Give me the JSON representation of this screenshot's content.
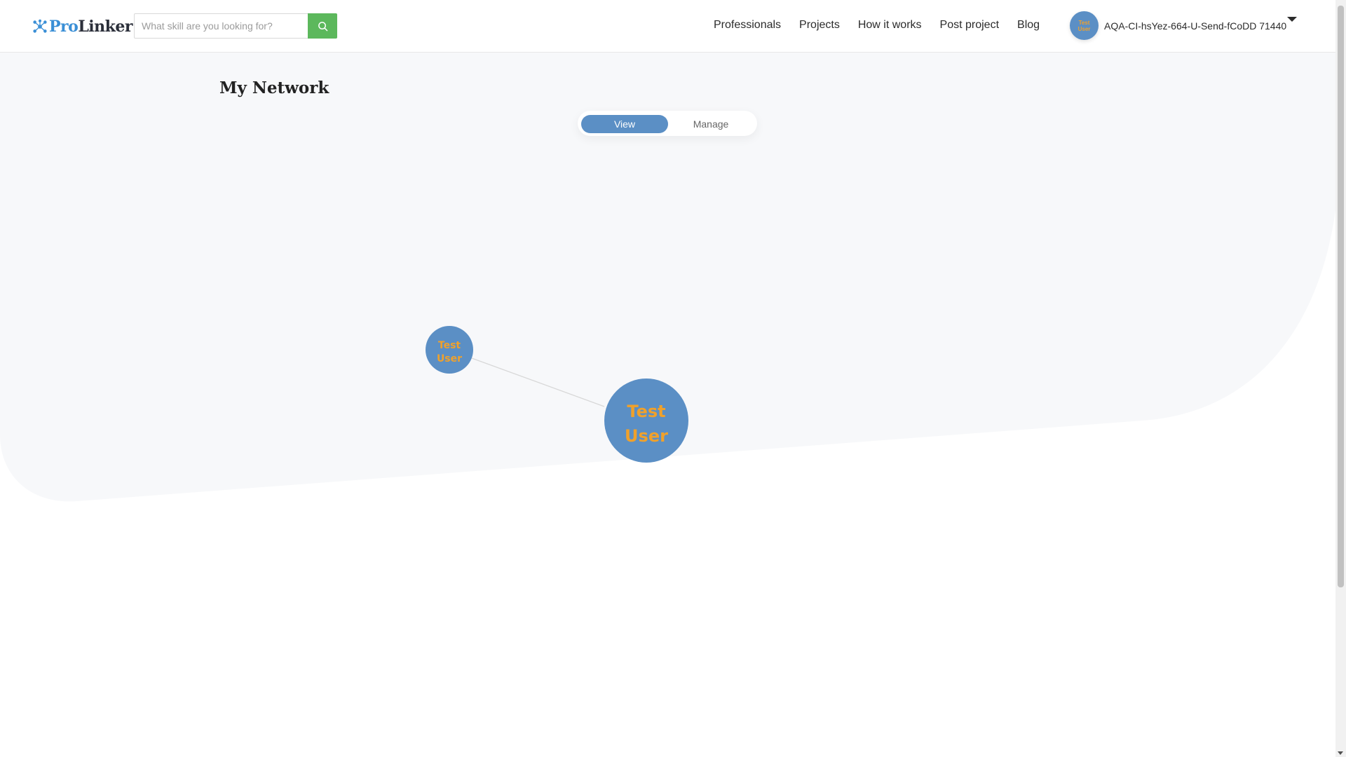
{
  "header": {
    "logo": {
      "pro": "Pro",
      "linker": "Linker"
    },
    "search": {
      "placeholder": "What skill are you looking for?"
    },
    "nav": [
      "Professionals",
      "Projects",
      "How it works",
      "Post project",
      "Blog"
    ],
    "user": {
      "name": "AQA-CI-hsYez-664-U-Send-fCoDD 71440",
      "avatar_text": [
        "Test",
        "User"
      ]
    }
  },
  "main": {
    "title": "My Network",
    "toggle": {
      "view": "View",
      "manage": "Manage",
      "selected": "View"
    }
  },
  "network": {
    "nodes": [
      {
        "label_line1": "Test",
        "label_line2": "User",
        "role": "connection"
      },
      {
        "label_line1": "Test",
        "label_line2": "User",
        "role": "me"
      }
    ],
    "links": [
      {
        "from": 0,
        "to": 1
      }
    ]
  },
  "colors": {
    "brand_blue": "#3a8fd6",
    "node_fill": "#5b8fc5",
    "node_text": "#f0a12b",
    "search_button": "#5cb85c",
    "bg_shape": "#f7f8fa"
  }
}
